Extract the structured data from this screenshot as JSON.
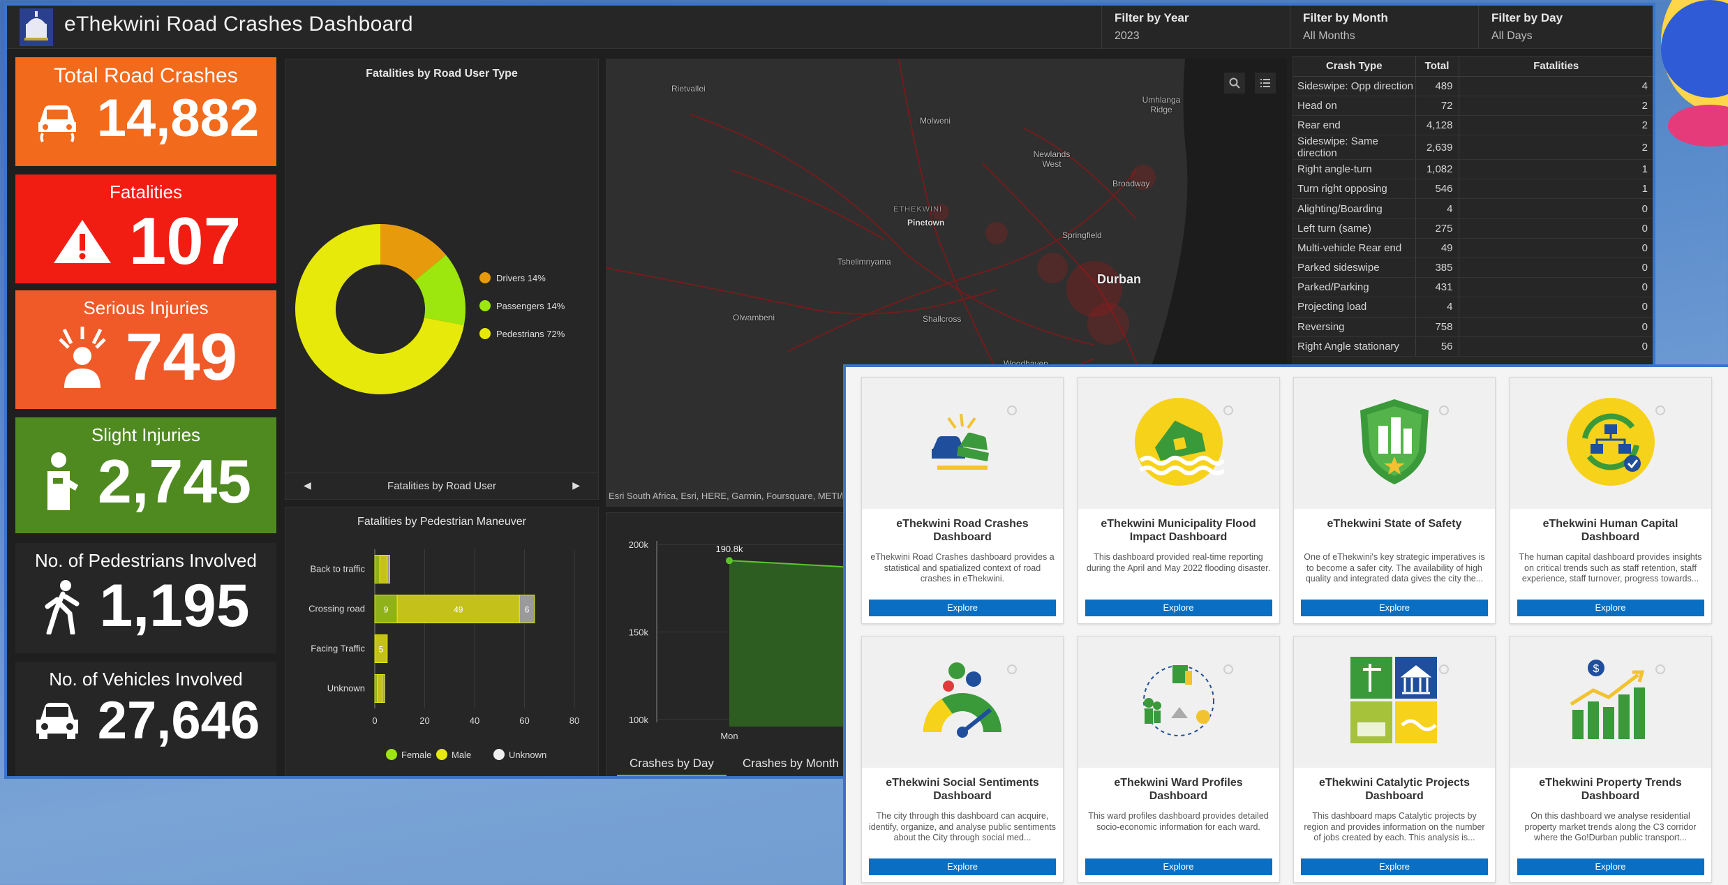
{
  "app": {
    "title": "eThekwini Road Crashes Dashboard"
  },
  "filters": [
    {
      "label": "Filter by Year",
      "value": "2023"
    },
    {
      "label": "Filter by Month",
      "value": "All Months"
    },
    {
      "label": "Filter by Day",
      "value": "All Days"
    }
  ],
  "kpis": [
    {
      "title": "Total Road Crashes",
      "value": "14,882",
      "color": "#f26a1b",
      "icon": "car-crash-icon"
    },
    {
      "title": "Fatalities",
      "value": "107",
      "color": "#f21d12",
      "icon": "warning-icon"
    },
    {
      "title": "Serious Injuries",
      "value": "749",
      "color": "#ef5a28",
      "icon": "injured-person-icon"
    },
    {
      "title": "Slight Injuries",
      "value": "2,745",
      "color": "#4f8a20",
      "icon": "hurt-person-icon"
    },
    {
      "title": "No. of Pedestrians Involved",
      "value": "1,195",
      "color": "#262626",
      "icon": "pedestrian-icon"
    },
    {
      "title": "No. of Vehicles Involved",
      "value": "27,646",
      "color": "#262626",
      "icon": "car-icon"
    }
  ],
  "donut": {
    "title": "Fatalities by Road User Type",
    "footer": "Fatalities by Road User",
    "chart_data": {
      "type": "pie",
      "categories": [
        "Drivers",
        "Passengers",
        "Pedestrians"
      ],
      "values": [
        14,
        14,
        72
      ],
      "labels": [
        "14%",
        "14%",
        "72%"
      ],
      "colors": [
        "#e79b0c",
        "#9de60e",
        "#e6e90a"
      ],
      "title": "Fatalities by Road User Type"
    }
  },
  "maneuver": {
    "title": "Fatalities by Pedestrian Maneuver",
    "chart_data": {
      "type": "bar",
      "orientation": "horizontal",
      "stacked": true,
      "categories": [
        "Back to traffic",
        "Crossing road",
        "Facing Traffic",
        "Unknown"
      ],
      "series": [
        {
          "name": "Female",
          "values": [
            2,
            9,
            0,
            1
          ],
          "color": "#8fb11a"
        },
        {
          "name": "Male",
          "values": [
            3,
            49,
            5,
            2
          ],
          "color": "#c4c21a"
        },
        {
          "name": "Unknown",
          "values": [
            1,
            6,
            0,
            1
          ],
          "color": "#9a9a9a"
        }
      ],
      "data_labels": {
        "Crossing road": [
          "9",
          "49",
          "6"
        ],
        "Facing Traffic": [
          "5"
        ],
        "Unknown": [
          "3"
        ]
      },
      "xticks": [
        "0",
        "20",
        "40",
        "60",
        "80"
      ],
      "xlim": [
        0,
        80
      ],
      "legend": "bottom"
    }
  },
  "table": {
    "headers": [
      "Crash Type",
      "Total",
      "Fatalities"
    ],
    "rows": [
      [
        "Sideswipe: Opp direction",
        "489",
        "4"
      ],
      [
        "Head on",
        "72",
        "2"
      ],
      [
        "Rear end",
        "4,128",
        "2"
      ],
      [
        "Sideswipe: Same direction",
        "2,639",
        "2"
      ],
      [
        "Right angle-turn",
        "1,082",
        "1"
      ],
      [
        "Turn right opposing",
        "546",
        "1"
      ],
      [
        "Alighting/Boarding",
        "4",
        "0"
      ],
      [
        "Left turn (same)",
        "275",
        "0"
      ],
      [
        "Multi-vehicle Rear end",
        "49",
        "0"
      ],
      [
        "Parked sideswipe",
        "385",
        "0"
      ],
      [
        "Parked/Parking",
        "431",
        "0"
      ],
      [
        "Projecting load",
        "4",
        "0"
      ],
      [
        "Reversing",
        "758",
        "0"
      ],
      [
        "Right Angle stationary",
        "56",
        "0"
      ]
    ]
  },
  "map": {
    "attribution": "Esri South Africa, Esri, HERE, Garmin, Foursquare, METI/N",
    "places": [
      {
        "name": "Rietvallei",
        "big": false
      },
      {
        "name": "Molweni",
        "big": false
      },
      {
        "name": "Umhlanga Ridge",
        "big": false
      },
      {
        "name": "Newlands West",
        "big": false
      },
      {
        "name": "Broadway",
        "big": false
      },
      {
        "name": "ETHEKWINI",
        "big": false
      },
      {
        "name": "Pinetown",
        "big": false
      },
      {
        "name": "Springfield",
        "big": false
      },
      {
        "name": "Tshelimnyama",
        "big": false
      },
      {
        "name": "Durban",
        "big": true
      },
      {
        "name": "Olwambeni",
        "big": false
      },
      {
        "name": "Shallcross",
        "big": false
      },
      {
        "name": "Woodhaven",
        "big": false
      }
    ]
  },
  "trend": {
    "chart_data": {
      "type": "area",
      "x": [
        "Mon"
      ],
      "values": [
        190800
      ],
      "point_label": "190.8k",
      "yticks": [
        "200k",
        "150k",
        "100k"
      ],
      "ylim": [
        100000,
        210000
      ]
    },
    "tabs": [
      "Crashes by Day",
      "Crashes by Month"
    ]
  },
  "cards": [
    {
      "title": "eThekwini Road Crashes Dashboard",
      "desc": "eThekwini Road Crashes dashboard provides a statistical and spatialized context of road crashes in eThekwini.",
      "button": "Explore",
      "icon": "crash-cars-icon"
    },
    {
      "title": "eThekwini Municipality Flood Impact Dashboard",
      "desc": "This dashboard provided real-time reporting during the April and May 2022 flooding disaster.",
      "button": "Explore",
      "icon": "flood-house-icon"
    },
    {
      "title": "eThekwini State of Safety",
      "desc": "One of eThekwini's key strategic imperatives is to become a safer city. The availability of high quality and integrated data gives the city the...",
      "button": "Explore",
      "icon": "safety-shield-icon"
    },
    {
      "title": "eThekwini Human Capital Dashboard",
      "desc": "The human capital dashboard provides insights on critical trends such as staff retention, staff experience, staff turnover, progress towards...",
      "button": "Explore",
      "icon": "human-capital-icon"
    },
    {
      "title": "eThekwini Social Sentiments Dashboard",
      "desc": "The city through this dashboard can acquire, identify, organize, and analyse public sentiments about the City through social med...",
      "button": "Explore",
      "icon": "sentiment-gauge-icon"
    },
    {
      "title": "eThekwini Ward Profiles Dashboard",
      "desc": "This ward profiles dashboard provides detailed socio-economic information for each ward.",
      "button": "Explore",
      "icon": "ward-profiles-icon"
    },
    {
      "title": "eThekwini Catalytic Projects Dashboard",
      "desc": "This dashboard maps Catalytic projects by region and provides information on the number of jobs created by each. This analysis is...",
      "button": "Explore",
      "icon": "catalytic-projects-icon"
    },
    {
      "title": "eThekwini Property Trends Dashboard",
      "desc": "On this dashboard we analyse residential property market trends along the C3 corridor where the Go!Durban public transport...",
      "button": "Explore",
      "icon": "property-trends-icon"
    }
  ]
}
